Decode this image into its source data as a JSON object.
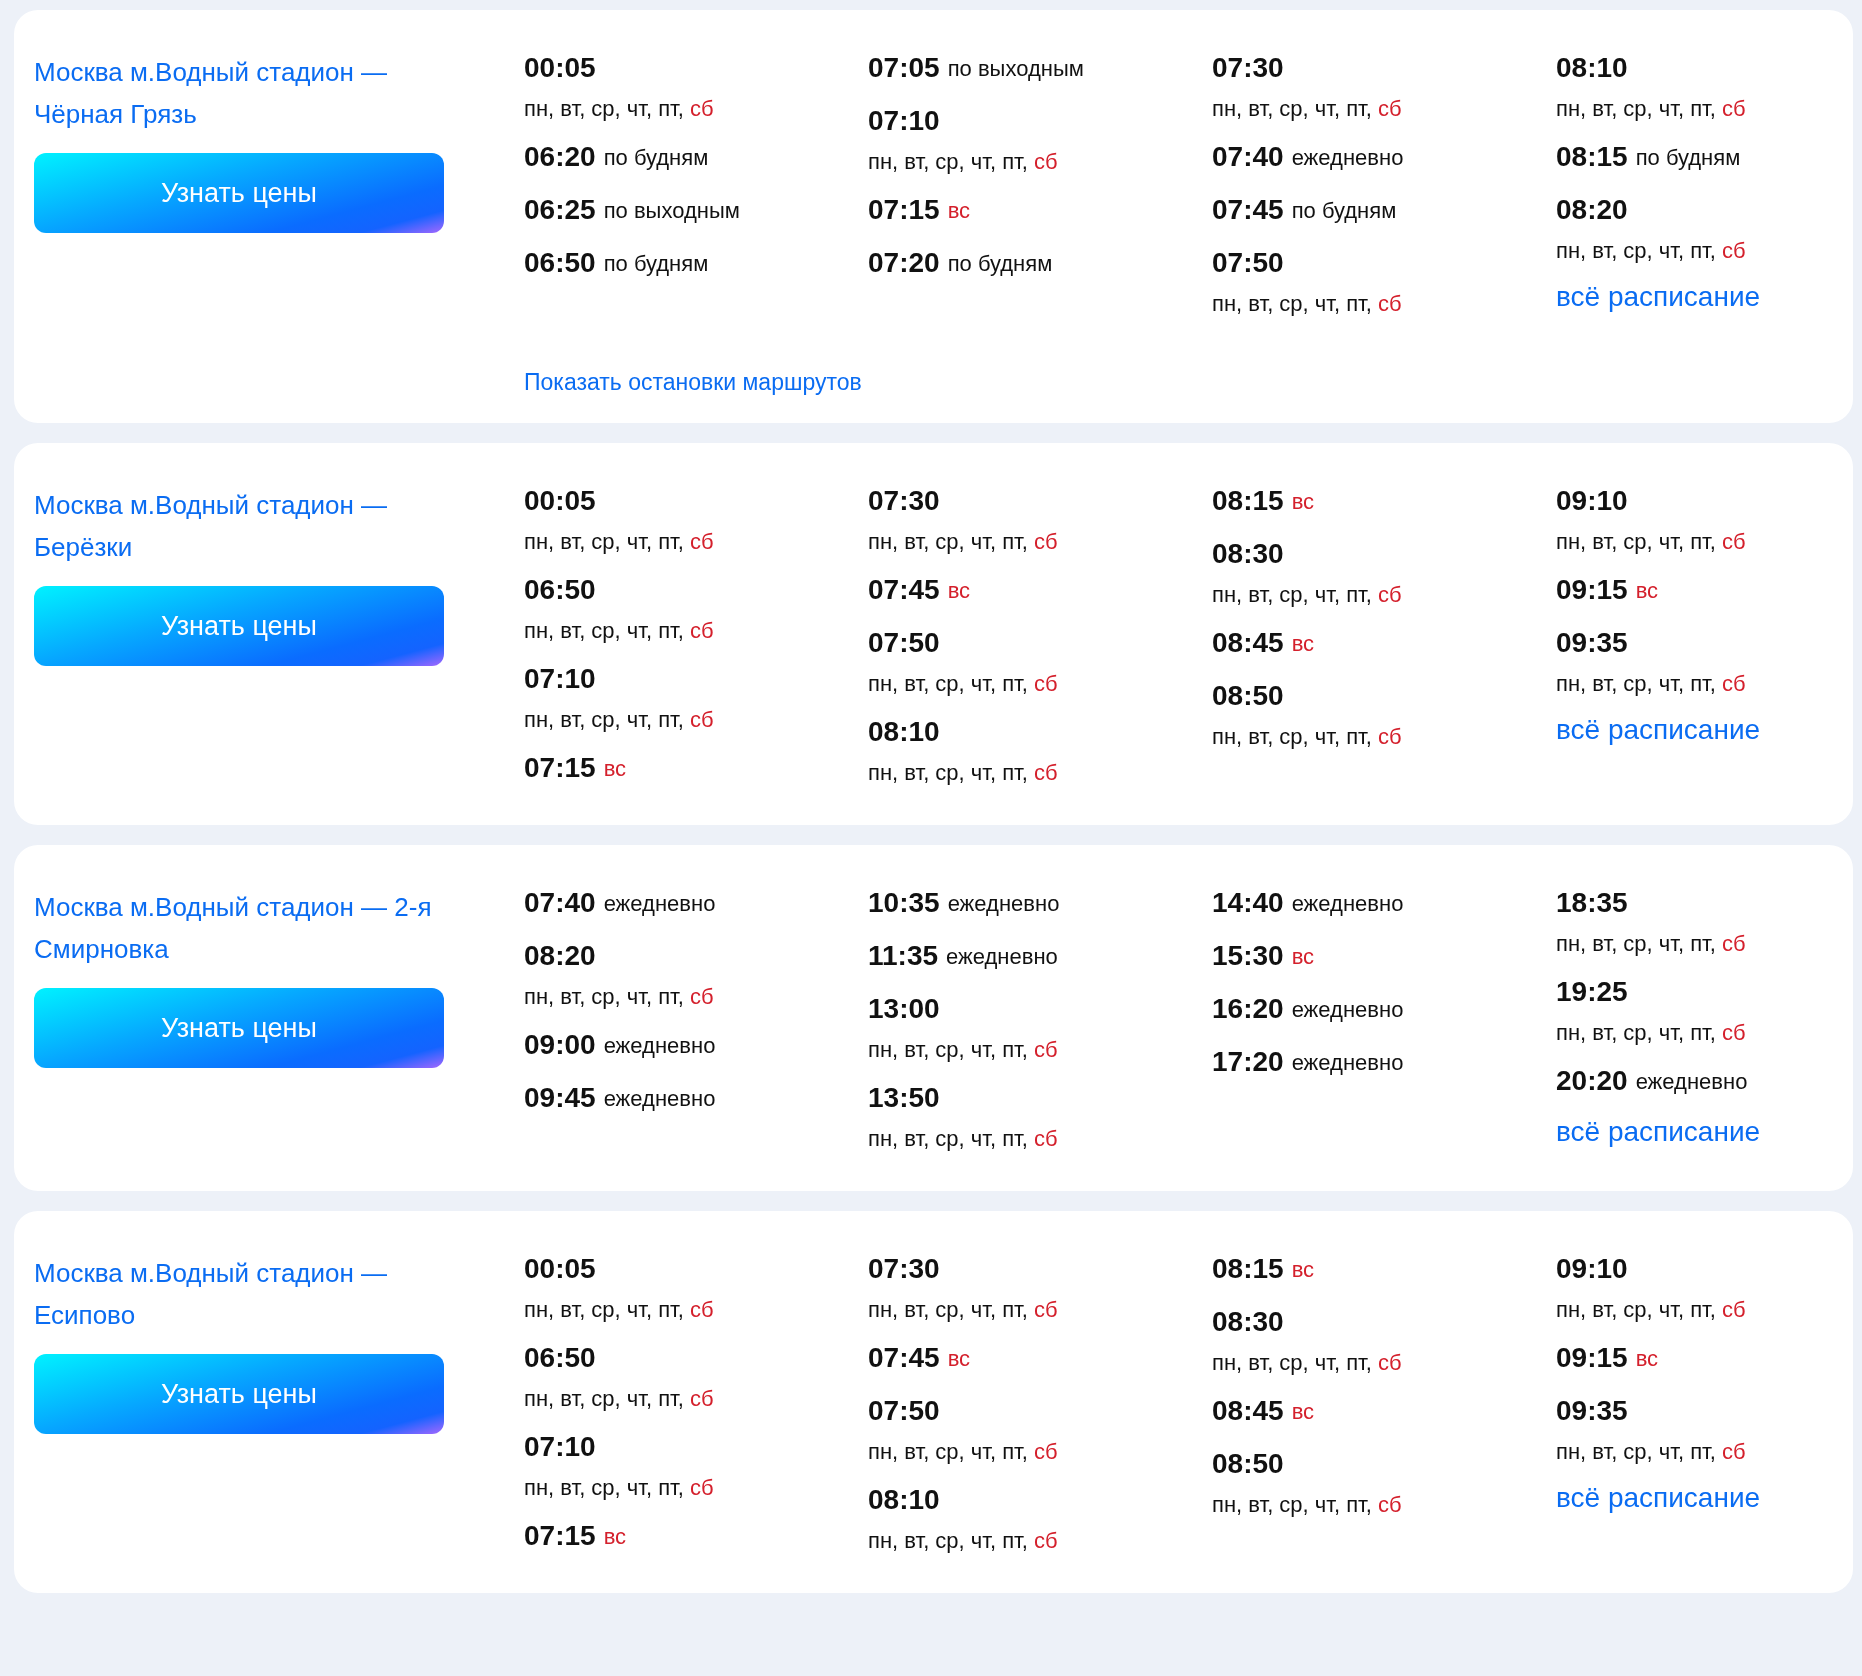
{
  "routes": [
    {
      "title": "Москва м.Водный стадион — Чёрная Грязь",
      "button": "Узнать цены",
      "columns": [
        {
          "entries": [
            {
              "time": "00:05",
              "kind": "below",
              "note": [
                {
                  "text": "пн, вт, ср, чт, пт,",
                  "weekend": false
                },
                {
                  "text": "сб",
                  "weekend": true
                }
              ]
            },
            {
              "time": "06:20",
              "kind": "inline",
              "note": [
                {
                  "text": "по будням",
                  "weekend": false
                }
              ]
            },
            {
              "time": "06:25",
              "kind": "inline",
              "note": [
                {
                  "text": "по выходным",
                  "weekend": false
                }
              ]
            },
            {
              "time": "06:50",
              "kind": "inline",
              "note": [
                {
                  "text": "по будням",
                  "weekend": false
                }
              ]
            }
          ]
        },
        {
          "entries": [
            {
              "time": "07:05",
              "kind": "inline",
              "note": [
                {
                  "text": "по выходным",
                  "weekend": false
                }
              ]
            },
            {
              "time": "07:10",
              "kind": "below",
              "note": [
                {
                  "text": "пн, вт, ср, чт, пт,",
                  "weekend": false
                },
                {
                  "text": "сб",
                  "weekend": true
                }
              ]
            },
            {
              "time": "07:15",
              "kind": "inline",
              "note": [
                {
                  "text": "вс",
                  "weekend": true
                }
              ]
            },
            {
              "time": "07:20",
              "kind": "inline",
              "note": [
                {
                  "text": "по будням",
                  "weekend": false
                }
              ]
            }
          ]
        },
        {
          "entries": [
            {
              "time": "07:30",
              "kind": "below",
              "note": [
                {
                  "text": "пн, вт, ср, чт, пт,",
                  "weekend": false
                },
                {
                  "text": "сб",
                  "weekend": true
                }
              ]
            },
            {
              "time": "07:40",
              "kind": "inline",
              "note": [
                {
                  "text": "ежедневно",
                  "weekend": false
                }
              ]
            },
            {
              "time": "07:45",
              "kind": "inline",
              "note": [
                {
                  "text": "по будням",
                  "weekend": false
                }
              ]
            },
            {
              "time": "07:50",
              "kind": "below",
              "note": [
                {
                  "text": "пн, вт, ср, чт, пт,",
                  "weekend": false
                },
                {
                  "text": "сб",
                  "weekend": true
                }
              ]
            }
          ]
        },
        {
          "entries": [
            {
              "time": "08:10",
              "kind": "below",
              "note": [
                {
                  "text": "пн, вт, ср, чт, пт,",
                  "weekend": false
                },
                {
                  "text": "сб",
                  "weekend": true
                }
              ]
            },
            {
              "time": "08:15",
              "kind": "inline",
              "note": [
                {
                  "text": "по будням",
                  "weekend": false
                }
              ]
            },
            {
              "time": "08:20",
              "kind": "below",
              "note": [
                {
                  "text": "пн, вт, ср, чт, пт,",
                  "weekend": false
                },
                {
                  "text": "сб",
                  "weekend": true
                }
              ]
            }
          ],
          "link": "всё расписание"
        }
      ],
      "footer_link": "Показать остановки маршрутов"
    },
    {
      "title": "Москва м.Водный стадион — Берёзки",
      "button": "Узнать цены",
      "columns": [
        {
          "entries": [
            {
              "time": "00:05",
              "kind": "below",
              "note": [
                {
                  "text": "пн, вт, ср, чт, пт,",
                  "weekend": false
                },
                {
                  "text": "сб",
                  "weekend": true
                }
              ]
            },
            {
              "time": "06:50",
              "kind": "below",
              "note": [
                {
                  "text": "пн, вт, ср, чт, пт,",
                  "weekend": false
                },
                {
                  "text": "сб",
                  "weekend": true
                }
              ]
            },
            {
              "time": "07:10",
              "kind": "below",
              "note": [
                {
                  "text": "пн, вт, ср, чт, пт,",
                  "weekend": false
                },
                {
                  "text": "сб",
                  "weekend": true
                }
              ]
            },
            {
              "time": "07:15",
              "kind": "inline",
              "note": [
                {
                  "text": "вс",
                  "weekend": true
                }
              ]
            }
          ]
        },
        {
          "entries": [
            {
              "time": "07:30",
              "kind": "below",
              "note": [
                {
                  "text": "пн, вт, ср, чт, пт,",
                  "weekend": false
                },
                {
                  "text": "сб",
                  "weekend": true
                }
              ]
            },
            {
              "time": "07:45",
              "kind": "inline",
              "note": [
                {
                  "text": "вс",
                  "weekend": true
                }
              ]
            },
            {
              "time": "07:50",
              "kind": "below",
              "note": [
                {
                  "text": "пн, вт, ср, чт, пт,",
                  "weekend": false
                },
                {
                  "text": "сб",
                  "weekend": true
                }
              ]
            },
            {
              "time": "08:10",
              "kind": "below",
              "note": [
                {
                  "text": "пн, вт, ср, чт, пт,",
                  "weekend": false
                },
                {
                  "text": "сб",
                  "weekend": true
                }
              ]
            }
          ]
        },
        {
          "entries": [
            {
              "time": "08:15",
              "kind": "inline",
              "note": [
                {
                  "text": "вс",
                  "weekend": true
                }
              ]
            },
            {
              "time": "08:30",
              "kind": "below",
              "note": [
                {
                  "text": "пн, вт, ср, чт, пт,",
                  "weekend": false
                },
                {
                  "text": "сб",
                  "weekend": true
                }
              ]
            },
            {
              "time": "08:45",
              "kind": "inline",
              "note": [
                {
                  "text": "вс",
                  "weekend": true
                }
              ]
            },
            {
              "time": "08:50",
              "kind": "below",
              "note": [
                {
                  "text": "пн, вт, ср, чт, пт,",
                  "weekend": false
                },
                {
                  "text": "сб",
                  "weekend": true
                }
              ]
            }
          ]
        },
        {
          "entries": [
            {
              "time": "09:10",
              "kind": "below",
              "note": [
                {
                  "text": "пн, вт, ср, чт, пт,",
                  "weekend": false
                },
                {
                  "text": "сб",
                  "weekend": true
                }
              ]
            },
            {
              "time": "09:15",
              "kind": "inline",
              "note": [
                {
                  "text": "вс",
                  "weekend": true
                }
              ]
            },
            {
              "time": "09:35",
              "kind": "below",
              "note": [
                {
                  "text": "пн, вт, ср, чт, пт,",
                  "weekend": false
                },
                {
                  "text": "сб",
                  "weekend": true
                }
              ]
            }
          ],
          "link": "всё расписание"
        }
      ]
    },
    {
      "title": "Москва м.Водный стадион — 2-я Смирновка",
      "button": "Узнать цены",
      "columns": [
        {
          "entries": [
            {
              "time": "07:40",
              "kind": "inline",
              "note": [
                {
                  "text": "ежедневно",
                  "weekend": false
                }
              ]
            },
            {
              "time": "08:20",
              "kind": "below",
              "note": [
                {
                  "text": "пн, вт, ср, чт, пт,",
                  "weekend": false
                },
                {
                  "text": "сб",
                  "weekend": true
                }
              ]
            },
            {
              "time": "09:00",
              "kind": "inline",
              "note": [
                {
                  "text": "ежедневно",
                  "weekend": false
                }
              ]
            },
            {
              "time": "09:45",
              "kind": "inline",
              "note": [
                {
                  "text": "ежедневно",
                  "weekend": false
                }
              ]
            }
          ]
        },
        {
          "entries": [
            {
              "time": "10:35",
              "kind": "inline",
              "note": [
                {
                  "text": "ежедневно",
                  "weekend": false
                }
              ]
            },
            {
              "time": "11:35",
              "kind": "inline",
              "note": [
                {
                  "text": "ежедневно",
                  "weekend": false
                }
              ]
            },
            {
              "time": "13:00",
              "kind": "below",
              "note": [
                {
                  "text": "пн, вт, ср, чт, пт,",
                  "weekend": false
                },
                {
                  "text": "сб",
                  "weekend": true
                }
              ]
            },
            {
              "time": "13:50",
              "kind": "below",
              "note": [
                {
                  "text": "пн, вт, ср, чт, пт,",
                  "weekend": false
                },
                {
                  "text": "сб",
                  "weekend": true
                }
              ]
            }
          ]
        },
        {
          "entries": [
            {
              "time": "14:40",
              "kind": "inline",
              "note": [
                {
                  "text": "ежедневно",
                  "weekend": false
                }
              ]
            },
            {
              "time": "15:30",
              "kind": "inline",
              "note": [
                {
                  "text": "вс",
                  "weekend": true
                }
              ]
            },
            {
              "time": "16:20",
              "kind": "inline",
              "note": [
                {
                  "text": "ежедневно",
                  "weekend": false
                }
              ]
            },
            {
              "time": "17:20",
              "kind": "inline",
              "note": [
                {
                  "text": "ежедневно",
                  "weekend": false
                }
              ]
            }
          ]
        },
        {
          "entries": [
            {
              "time": "18:35",
              "kind": "below",
              "note": [
                {
                  "text": "пн, вт, ср, чт, пт,",
                  "weekend": false
                },
                {
                  "text": "сб",
                  "weekend": true
                }
              ]
            },
            {
              "time": "19:25",
              "kind": "below",
              "note": [
                {
                  "text": "пн, вт, ср, чт, пт,",
                  "weekend": false
                },
                {
                  "text": "сб",
                  "weekend": true
                }
              ]
            },
            {
              "time": "20:20",
              "kind": "inline",
              "note": [
                {
                  "text": "ежедневно",
                  "weekend": false
                }
              ]
            }
          ],
          "link": "всё расписание"
        }
      ]
    },
    {
      "title": "Москва м.Водный стадион — Есипово",
      "button": "Узнать цены",
      "columns": [
        {
          "entries": [
            {
              "time": "00:05",
              "kind": "below",
              "note": [
                {
                  "text": "пн, вт, ср, чт, пт,",
                  "weekend": false
                },
                {
                  "text": "сб",
                  "weekend": true
                }
              ]
            },
            {
              "time": "06:50",
              "kind": "below",
              "note": [
                {
                  "text": "пн, вт, ср, чт, пт,",
                  "weekend": false
                },
                {
                  "text": "сб",
                  "weekend": true
                }
              ]
            },
            {
              "time": "07:10",
              "kind": "below",
              "note": [
                {
                  "text": "пн, вт, ср, чт, пт,",
                  "weekend": false
                },
                {
                  "text": "сб",
                  "weekend": true
                }
              ]
            },
            {
              "time": "07:15",
              "kind": "inline",
              "note": [
                {
                  "text": "вс",
                  "weekend": true
                }
              ]
            }
          ]
        },
        {
          "entries": [
            {
              "time": "07:30",
              "kind": "below",
              "note": [
                {
                  "text": "пн, вт, ср, чт, пт,",
                  "weekend": false
                },
                {
                  "text": "сб",
                  "weekend": true
                }
              ]
            },
            {
              "time": "07:45",
              "kind": "inline",
              "note": [
                {
                  "text": "вс",
                  "weekend": true
                }
              ]
            },
            {
              "time": "07:50",
              "kind": "below",
              "note": [
                {
                  "text": "пн, вт, ср, чт, пт,",
                  "weekend": false
                },
                {
                  "text": "сб",
                  "weekend": true
                }
              ]
            },
            {
              "time": "08:10",
              "kind": "below",
              "note": [
                {
                  "text": "пн, вт, ср, чт, пт,",
                  "weekend": false
                },
                {
                  "text": "сб",
                  "weekend": true
                }
              ]
            }
          ]
        },
        {
          "entries": [
            {
              "time": "08:15",
              "kind": "inline",
              "note": [
                {
                  "text": "вс",
                  "weekend": true
                }
              ]
            },
            {
              "time": "08:30",
              "kind": "below",
              "note": [
                {
                  "text": "пн, вт, ср, чт, пт,",
                  "weekend": false
                },
                {
                  "text": "сб",
                  "weekend": true
                }
              ]
            },
            {
              "time": "08:45",
              "kind": "inline",
              "note": [
                {
                  "text": "вс",
                  "weekend": true
                }
              ]
            },
            {
              "time": "08:50",
              "kind": "below",
              "note": [
                {
                  "text": "пн, вт, ср, чт, пт,",
                  "weekend": false
                },
                {
                  "text": "сб",
                  "weekend": true
                }
              ]
            }
          ]
        },
        {
          "entries": [
            {
              "time": "09:10",
              "kind": "below",
              "note": [
                {
                  "text": "пн, вт, ср, чт, пт,",
                  "weekend": false
                },
                {
                  "text": "сб",
                  "weekend": true
                }
              ]
            },
            {
              "time": "09:15",
              "kind": "inline",
              "note": [
                {
                  "text": "вс",
                  "weekend": true
                }
              ]
            },
            {
              "time": "09:35",
              "kind": "below",
              "note": [
                {
                  "text": "пн, вт, ср, чт, пт,",
                  "weekend": false
                },
                {
                  "text": "сб",
                  "weekend": true
                }
              ]
            }
          ],
          "link": "всё расписание"
        }
      ]
    }
  ]
}
